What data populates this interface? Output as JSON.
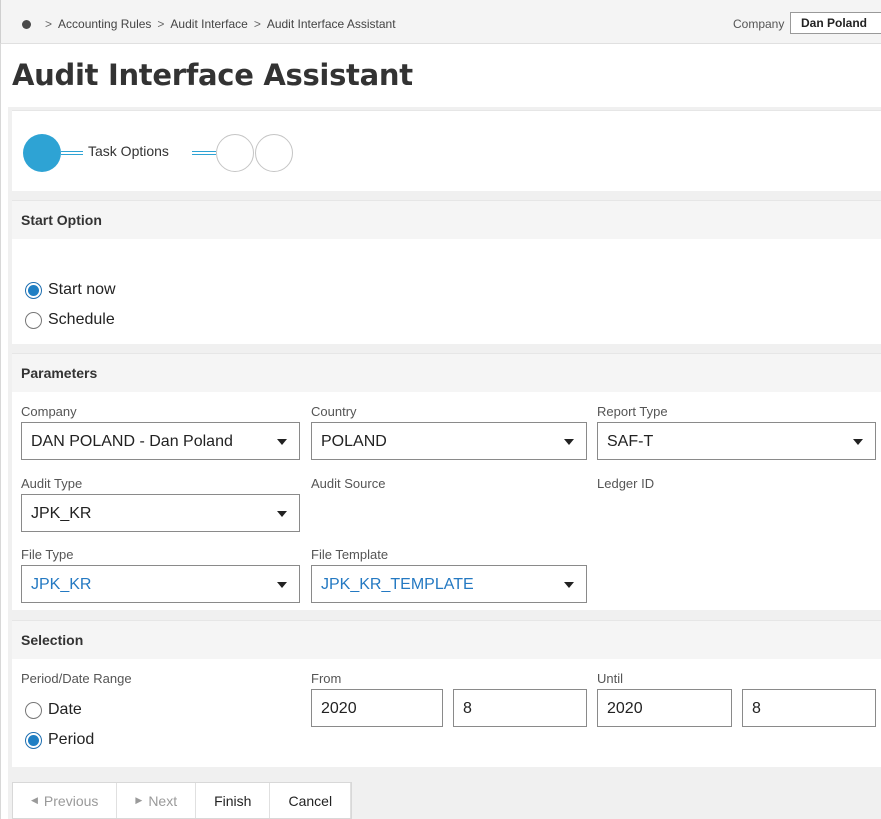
{
  "breadcrumb": {
    "items": [
      "Accounting Rules",
      "Audit Interface",
      "Audit Interface Assistant"
    ],
    "separator": ">"
  },
  "header": {
    "company_label": "Company",
    "company_value": "Dan Poland"
  },
  "page": {
    "title": "Audit Interface Assistant"
  },
  "wizard": {
    "step_label": "Task Options",
    "steps_total": 3,
    "current_step": 1,
    "accent": "#2ea3d4"
  },
  "start_option": {
    "heading": "Start Option",
    "options": [
      {
        "label": "Start now",
        "selected": true
      },
      {
        "label": "Schedule",
        "selected": false
      }
    ]
  },
  "parameters": {
    "heading": "Parameters",
    "company": {
      "label": "Company",
      "value": "DAN POLAND - Dan Poland"
    },
    "country": {
      "label": "Country",
      "value": "POLAND"
    },
    "report_type": {
      "label": "Report Type",
      "value": "SAF-T"
    },
    "audit_type": {
      "label": "Audit Type",
      "value": "JPK_KR"
    },
    "audit_source": {
      "label": "Audit Source"
    },
    "ledger_id": {
      "label": "Ledger ID"
    },
    "file_type": {
      "label": "File Type",
      "value": "JPK_KR"
    },
    "file_template": {
      "label": "File Template",
      "value": "JPK_KR_TEMPLATE"
    }
  },
  "selection": {
    "heading": "Selection",
    "range_label": "Period/Date Range",
    "options": [
      {
        "label": "Date",
        "selected": false
      },
      {
        "label": "Period",
        "selected": true
      }
    ],
    "from": {
      "label": "From",
      "year": "2020",
      "period": "8"
    },
    "until": {
      "label": "Until",
      "year": "2020",
      "period": "8"
    }
  },
  "buttons": {
    "previous": "Previous",
    "next": "Next",
    "finish": "Finish",
    "cancel": "Cancel"
  }
}
